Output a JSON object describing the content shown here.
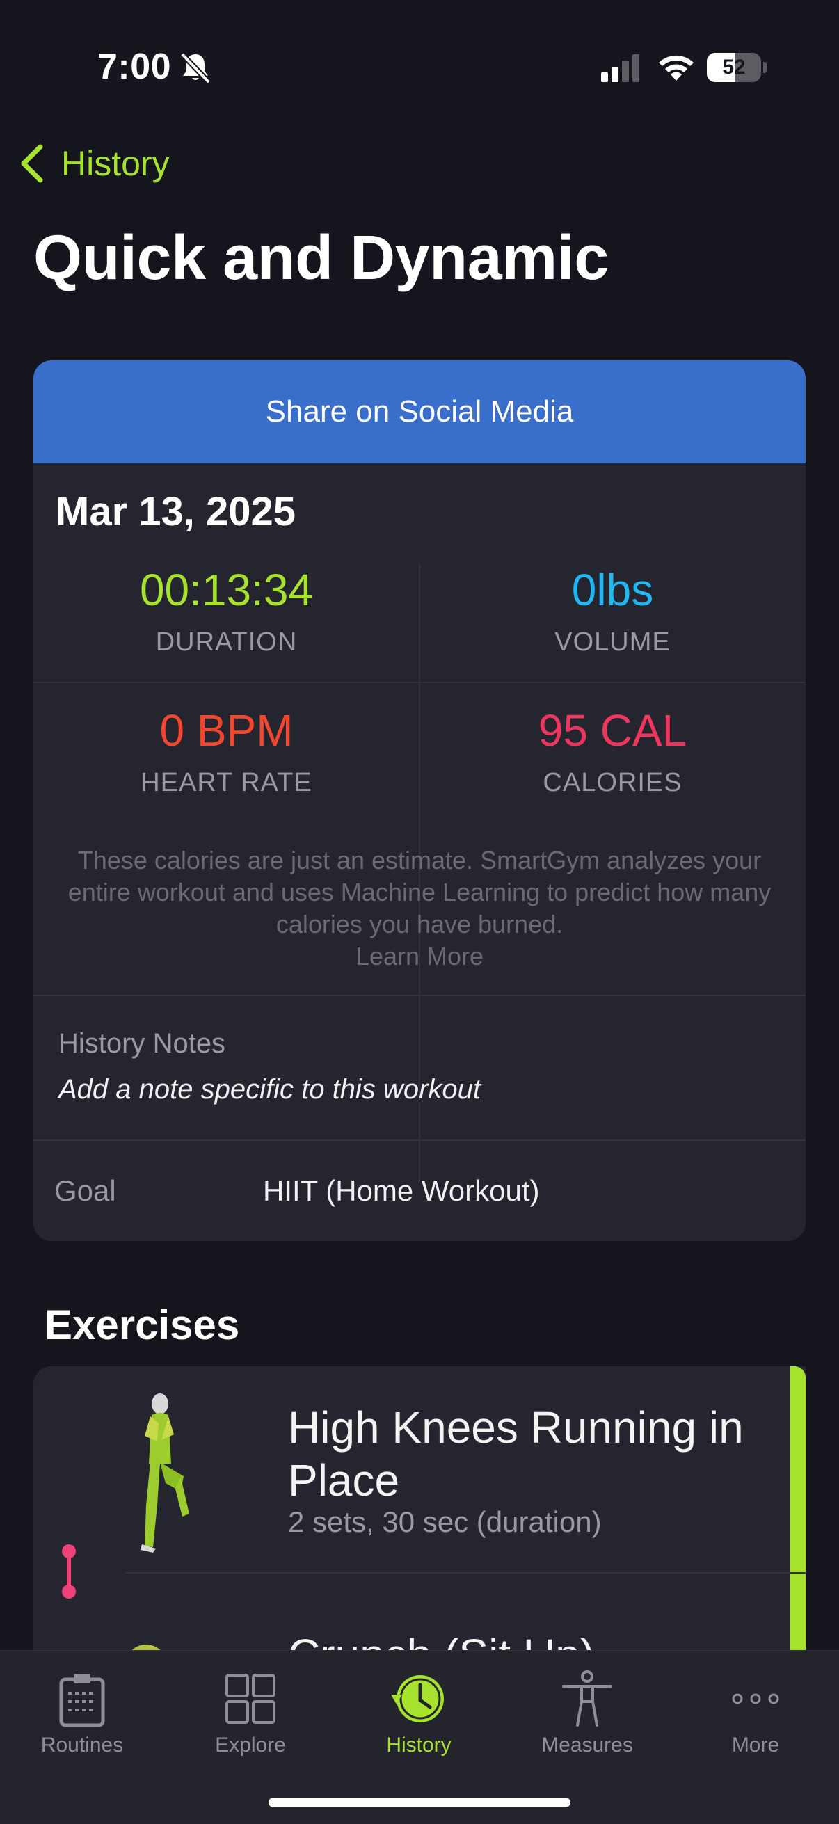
{
  "status_bar": {
    "time": "7:00",
    "battery": "52",
    "battery_percent": 52
  },
  "nav": {
    "back_label": "History"
  },
  "page_title": "Quick and Dynamic",
  "summary": {
    "share_label": "Share on Social Media",
    "date": "Mar 13, 2025",
    "stats": {
      "duration": {
        "value": "00:13:34",
        "label": "DURATION",
        "color": "#a6e22e"
      },
      "volume": {
        "value": "0lbs",
        "label": "VOLUME",
        "color": "#21b7f0"
      },
      "heart_rate": {
        "value": "0 BPM",
        "label": "HEART RATE",
        "color": "#f2472e"
      },
      "calories": {
        "value": "95 CAL",
        "label": "CALORIES",
        "color": "#f0365e"
      }
    },
    "calorie_note": "These calories are just an estimate. SmartGym analyzes your entire workout and uses Machine Learning to predict how many calories you have burned.",
    "learn_more": "Learn More",
    "history_notes_label": "History Notes",
    "history_notes_placeholder": "Add a note specific to this workout",
    "goal_label": "Goal",
    "goal_value": "HIIT (Home Workout)"
  },
  "exercises": {
    "title": "Exercises",
    "items": [
      {
        "name": "High Knees Running in Place",
        "detail": "2 sets, 30 sec (duration)"
      },
      {
        "name": "Crunch (Sit Up)",
        "detail": ""
      }
    ]
  },
  "tab_bar": {
    "items": [
      {
        "label": "Routines",
        "icon": "clipboard-icon"
      },
      {
        "label": "Explore",
        "icon": "grid-icon"
      },
      {
        "label": "History",
        "icon": "clock-history-icon",
        "active": true
      },
      {
        "label": "Measures",
        "icon": "body-figure-icon"
      },
      {
        "label": "More",
        "icon": "ellipsis-icon"
      }
    ]
  },
  "colors": {
    "accent": "#a6e22e",
    "share_blue": "#3a6ecb",
    "background": "#15151d",
    "card": "#25252f"
  }
}
